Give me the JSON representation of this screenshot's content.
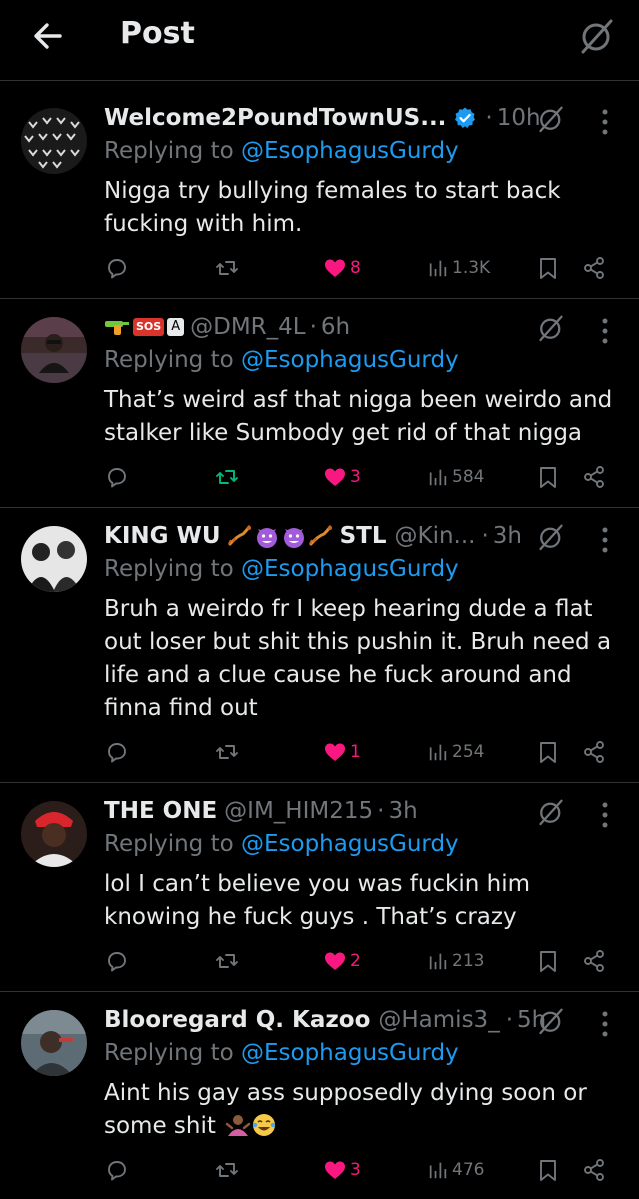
{
  "header": {
    "title": "Post"
  },
  "replies": [
    {
      "name": "Welcome2PoundTownUS...",
      "handle": "",
      "time": "10h",
      "replying_label": "Replying to",
      "replying_to": "@EsophagusGurdy",
      "text": "Nigga try bullying females to start back fucking with him.",
      "likes": "8",
      "retweets": "",
      "views": "1.3K"
    },
    {
      "name": "",
      "handle": "@DMR_4L",
      "time": "6h",
      "replying_label": "Replying to",
      "replying_to": "@EsophagusGurdy",
      "badge_sos": "SOS",
      "badge_a": "A",
      "text": "That’s weird asf that nigga been weirdo and stalker like Sumbody get rid of that nigga",
      "likes": "3",
      "retweets": "",
      "views": "584"
    },
    {
      "name_part1": "KING WU",
      "name_part2": "STL",
      "handle": "@Kin...",
      "time": "3h",
      "replying_label": "Replying to",
      "replying_to": "@EsophagusGurdy",
      "text": "Bruh a weirdo fr I keep hearing dude a flat out loser but shit this pushin it. Bruh need a life and a clue cause he fuck around and finna find out",
      "likes": "1",
      "retweets": "",
      "views": "254"
    },
    {
      "name": "THE ONE",
      "handle": "@IM_HIM215",
      "time": "3h",
      "replying_label": "Replying to",
      "replying_to": "@EsophagusGurdy",
      "text": "lol I can’t believe you was fuckin him knowing he fuck guys . That’s crazy",
      "likes": "2",
      "retweets": "",
      "views": "213"
    },
    {
      "name": "Blooregard Q. Kazoo",
      "handle": "@Hamis3_",
      "time": "5h",
      "replying_label": "Replying to",
      "replying_to": "@EsophagusGurdy",
      "text": "Aint his gay ass supposedly dying soon or some shit",
      "likes": "3",
      "retweets": "",
      "views": "476"
    }
  ],
  "colors": {
    "accent": "#1d9bf0",
    "like": "#f91880",
    "retweet": "#00ba7c",
    "muted": "#71767b",
    "text": "#e7e9ea",
    "border": "#2f3336"
  },
  "icons": [
    "back-arrow-icon",
    "grok-icon",
    "verified-badge-icon",
    "more-icon",
    "reply-icon",
    "retweet-icon",
    "like-icon",
    "views-icon",
    "bookmark-icon",
    "share-icon"
  ]
}
